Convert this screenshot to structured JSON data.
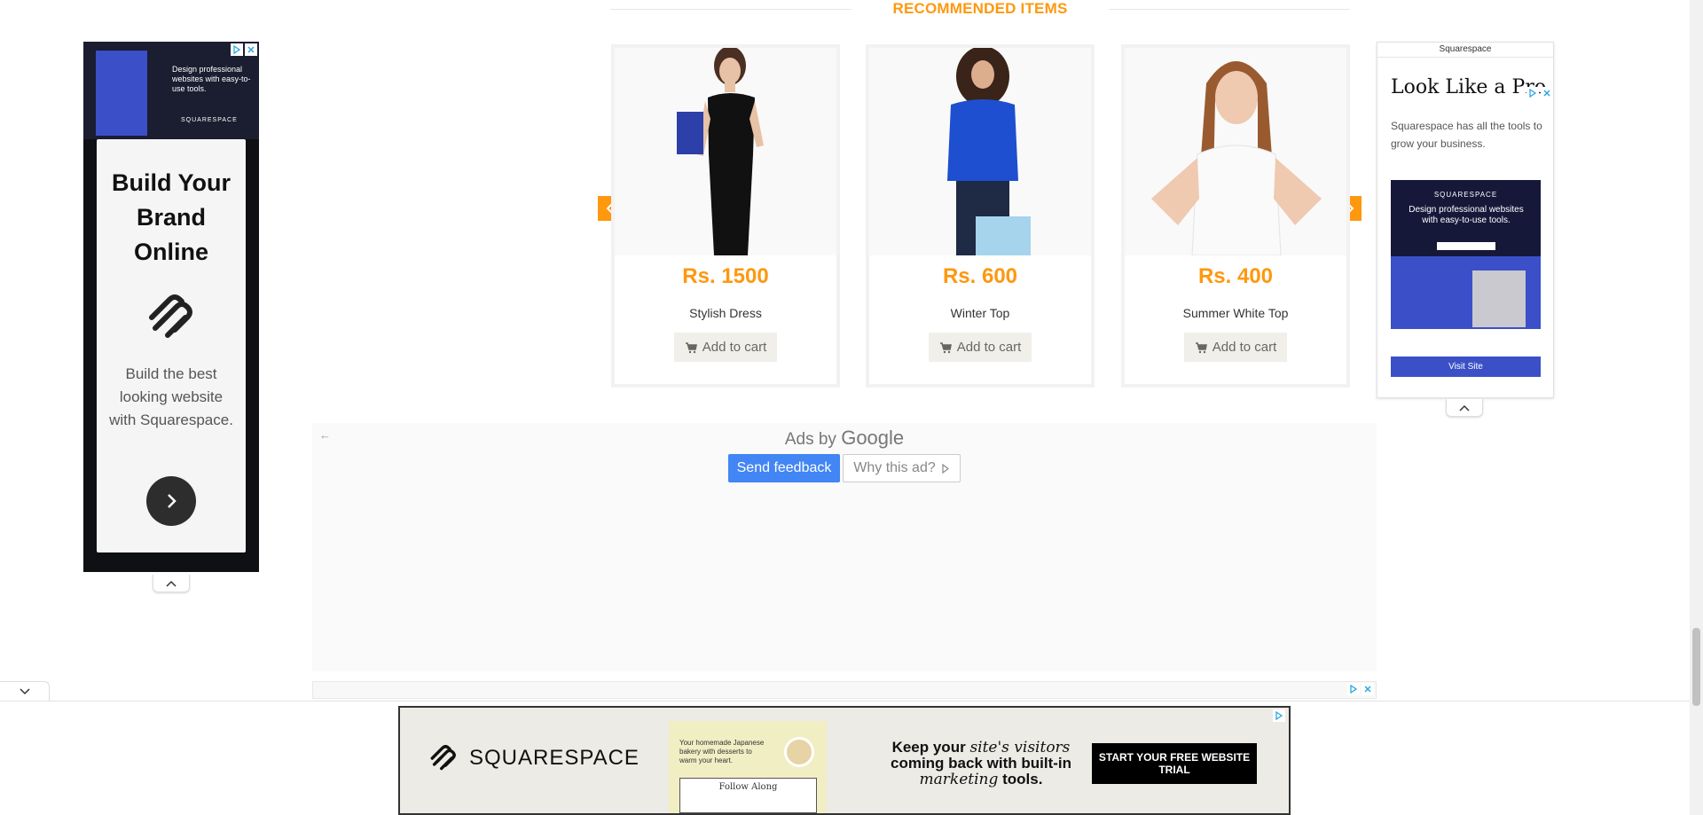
{
  "recommended": {
    "title": "RECOMMENDED ITEMS",
    "products": [
      {
        "price": "Rs. 1500",
        "name": "Stylish Dress",
        "add_label": "Add to cart"
      },
      {
        "price": "Rs. 600",
        "name": "Winter Top",
        "add_label": "Add to cart"
      },
      {
        "price": "Rs. 400",
        "name": "Summer White Top",
        "add_label": "Add to cart"
      }
    ],
    "accent_color": "#fe980f"
  },
  "left_ad": {
    "banner_text": "Design professional websites with easy-to-use tools.",
    "banner_logo": "SQUARESPACE",
    "headline": "Build Your Brand Online",
    "body": "Build the best looking website with Squarespace."
  },
  "right_ad": {
    "brand": "Squarespace",
    "headline": "Look Like a Pro",
    "description": "Squarespace has all the tools to grow your business.",
    "image_logo": "SQUARESPACE",
    "image_text": "Design professional websites with easy-to-use tools.",
    "visit_label": "Visit Site"
  },
  "google_ads": {
    "ads_by": "Ads by",
    "google": "Google",
    "send_feedback": "Send feedback",
    "why_this_ad": "Why this ad?"
  },
  "bottom_ad": {
    "logo": "SQUARESPACE",
    "mini_text": "Your homemade Japanese bakery with desserts to warm your heart.",
    "follow_along": "Follow Along",
    "copy_line1": "Keep your",
    "copy_italic1": "site's visitors",
    "copy_line2": "coming back with built-in",
    "copy_italic2": "marketing",
    "copy_line3": "tools.",
    "cta": "START YOUR FREE WEBSITE TRIAL"
  },
  "icons": {
    "prev": "chevron-left-icon",
    "next": "chevron-right-icon",
    "cart": "cart-icon",
    "collapse": "chevron-up-icon",
    "expand": "chevron-down-icon"
  }
}
